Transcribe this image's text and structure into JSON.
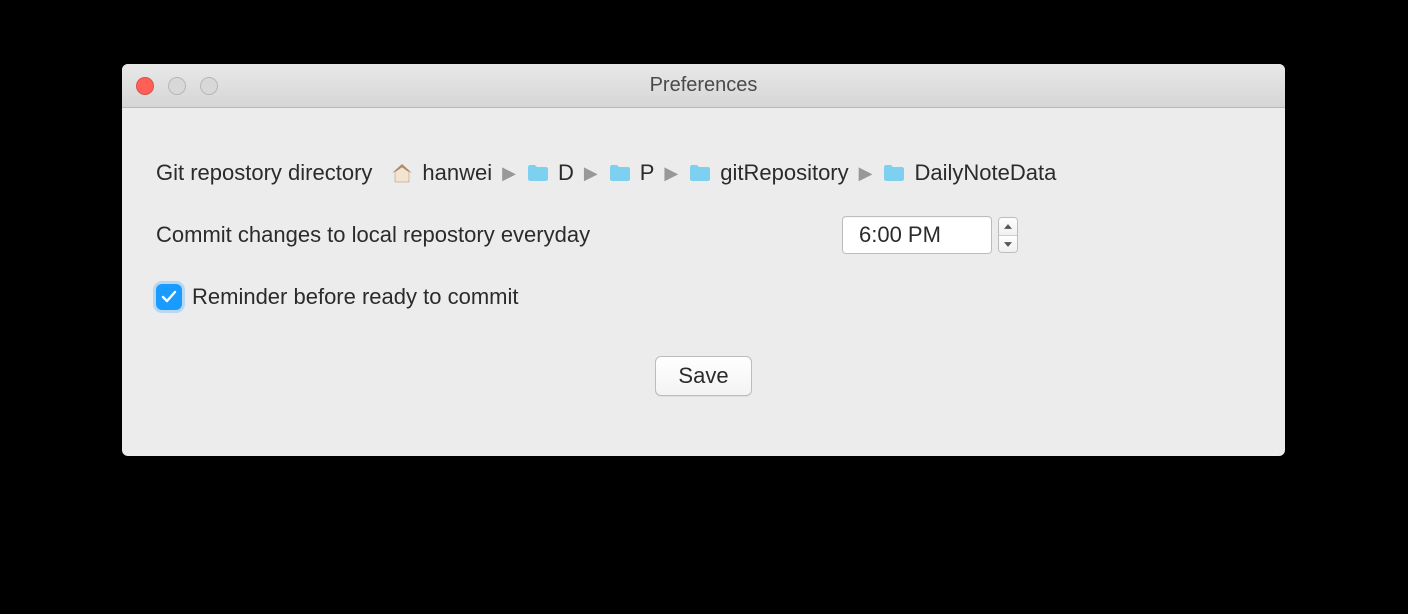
{
  "window": {
    "title": "Preferences"
  },
  "labels": {
    "repo_dir": "Git repostory directory",
    "commit_every": "Commit changes to local repostory everyday",
    "reminder": "Reminder before ready to commit",
    "save": "Save"
  },
  "values": {
    "commit_time": "6:00 PM",
    "reminder_checked": true
  },
  "breadcrumb": [
    {
      "icon": "home",
      "label": "hanwei"
    },
    {
      "icon": "folder",
      "label": "D"
    },
    {
      "icon": "folder",
      "label": "P"
    },
    {
      "icon": "folder",
      "label": "gitRepository"
    },
    {
      "icon": "folder",
      "label": "DailyNoteData"
    }
  ]
}
